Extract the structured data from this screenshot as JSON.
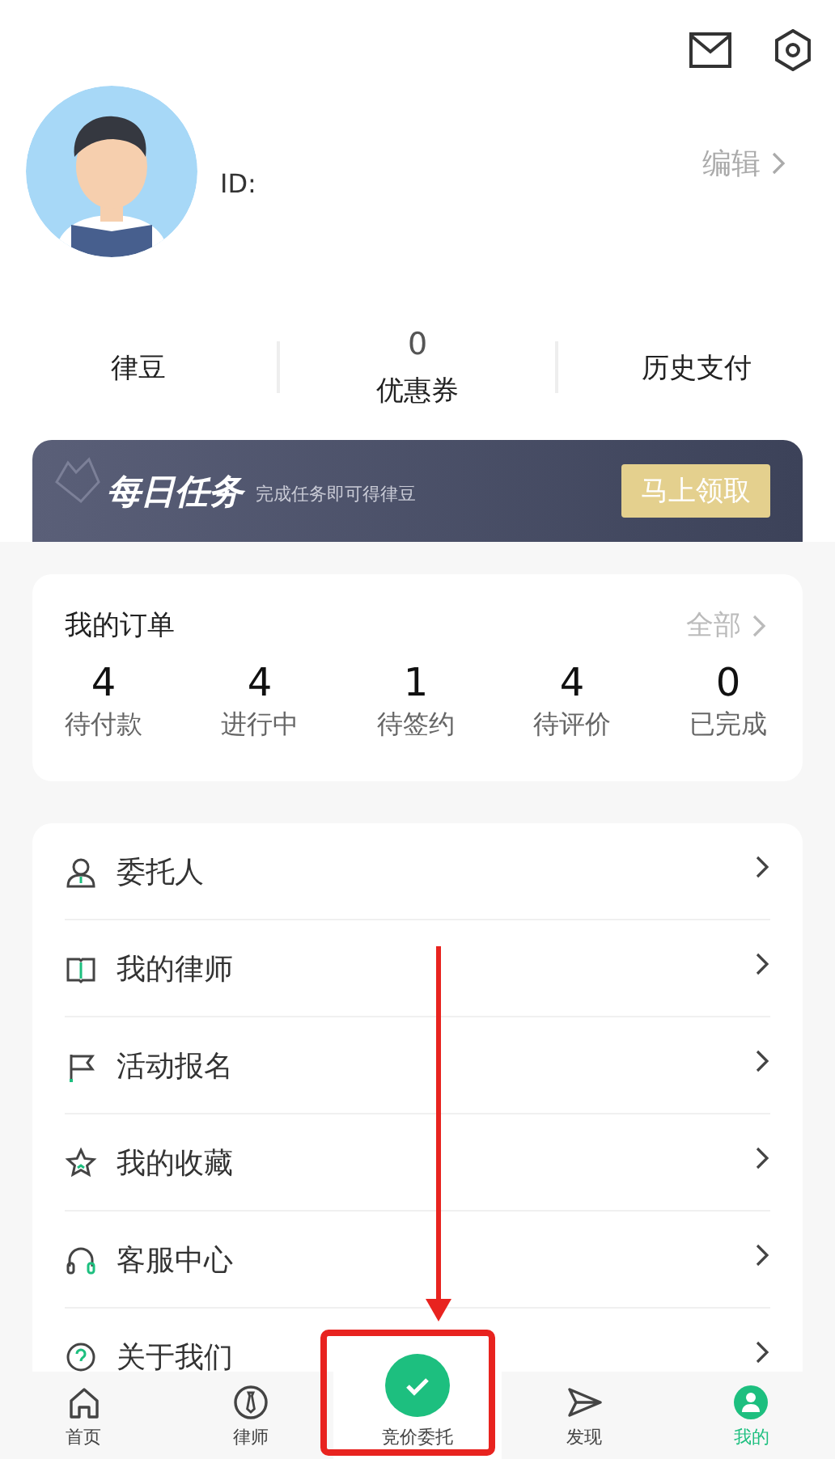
{
  "profile": {
    "id_label": "ID:",
    "edit": "编辑"
  },
  "stats": [
    {
      "label": "律豆"
    },
    {
      "value": "0",
      "label": "优惠券"
    },
    {
      "label": "历史支付"
    }
  ],
  "daily_task": {
    "title": "每日任务",
    "subtitle": "完成任务即可得律豆",
    "button": "马上领取"
  },
  "orders": {
    "title": "我的订单",
    "all": "全部",
    "items": [
      {
        "count": "4",
        "label": "待付款"
      },
      {
        "count": "4",
        "label": "进行中"
      },
      {
        "count": "1",
        "label": "待签约"
      },
      {
        "count": "4",
        "label": "待评价"
      },
      {
        "count": "0",
        "label": "已完成"
      }
    ]
  },
  "menu": [
    {
      "label": "委托人"
    },
    {
      "label": "我的律师"
    },
    {
      "label": "活动报名"
    },
    {
      "label": "我的收藏"
    },
    {
      "label": "客服中心"
    },
    {
      "label": "关于我们"
    }
  ],
  "tab_bar": [
    {
      "label": "首页",
      "kind": "normal",
      "selected": false
    },
    {
      "label": "律师",
      "kind": "normal",
      "selected": false
    },
    {
      "label": "竞价委托",
      "kind": "center",
      "selected": false
    },
    {
      "label": "发现",
      "kind": "normal",
      "selected": false
    },
    {
      "label": "我的",
      "kind": "normal",
      "selected": true
    }
  ]
}
